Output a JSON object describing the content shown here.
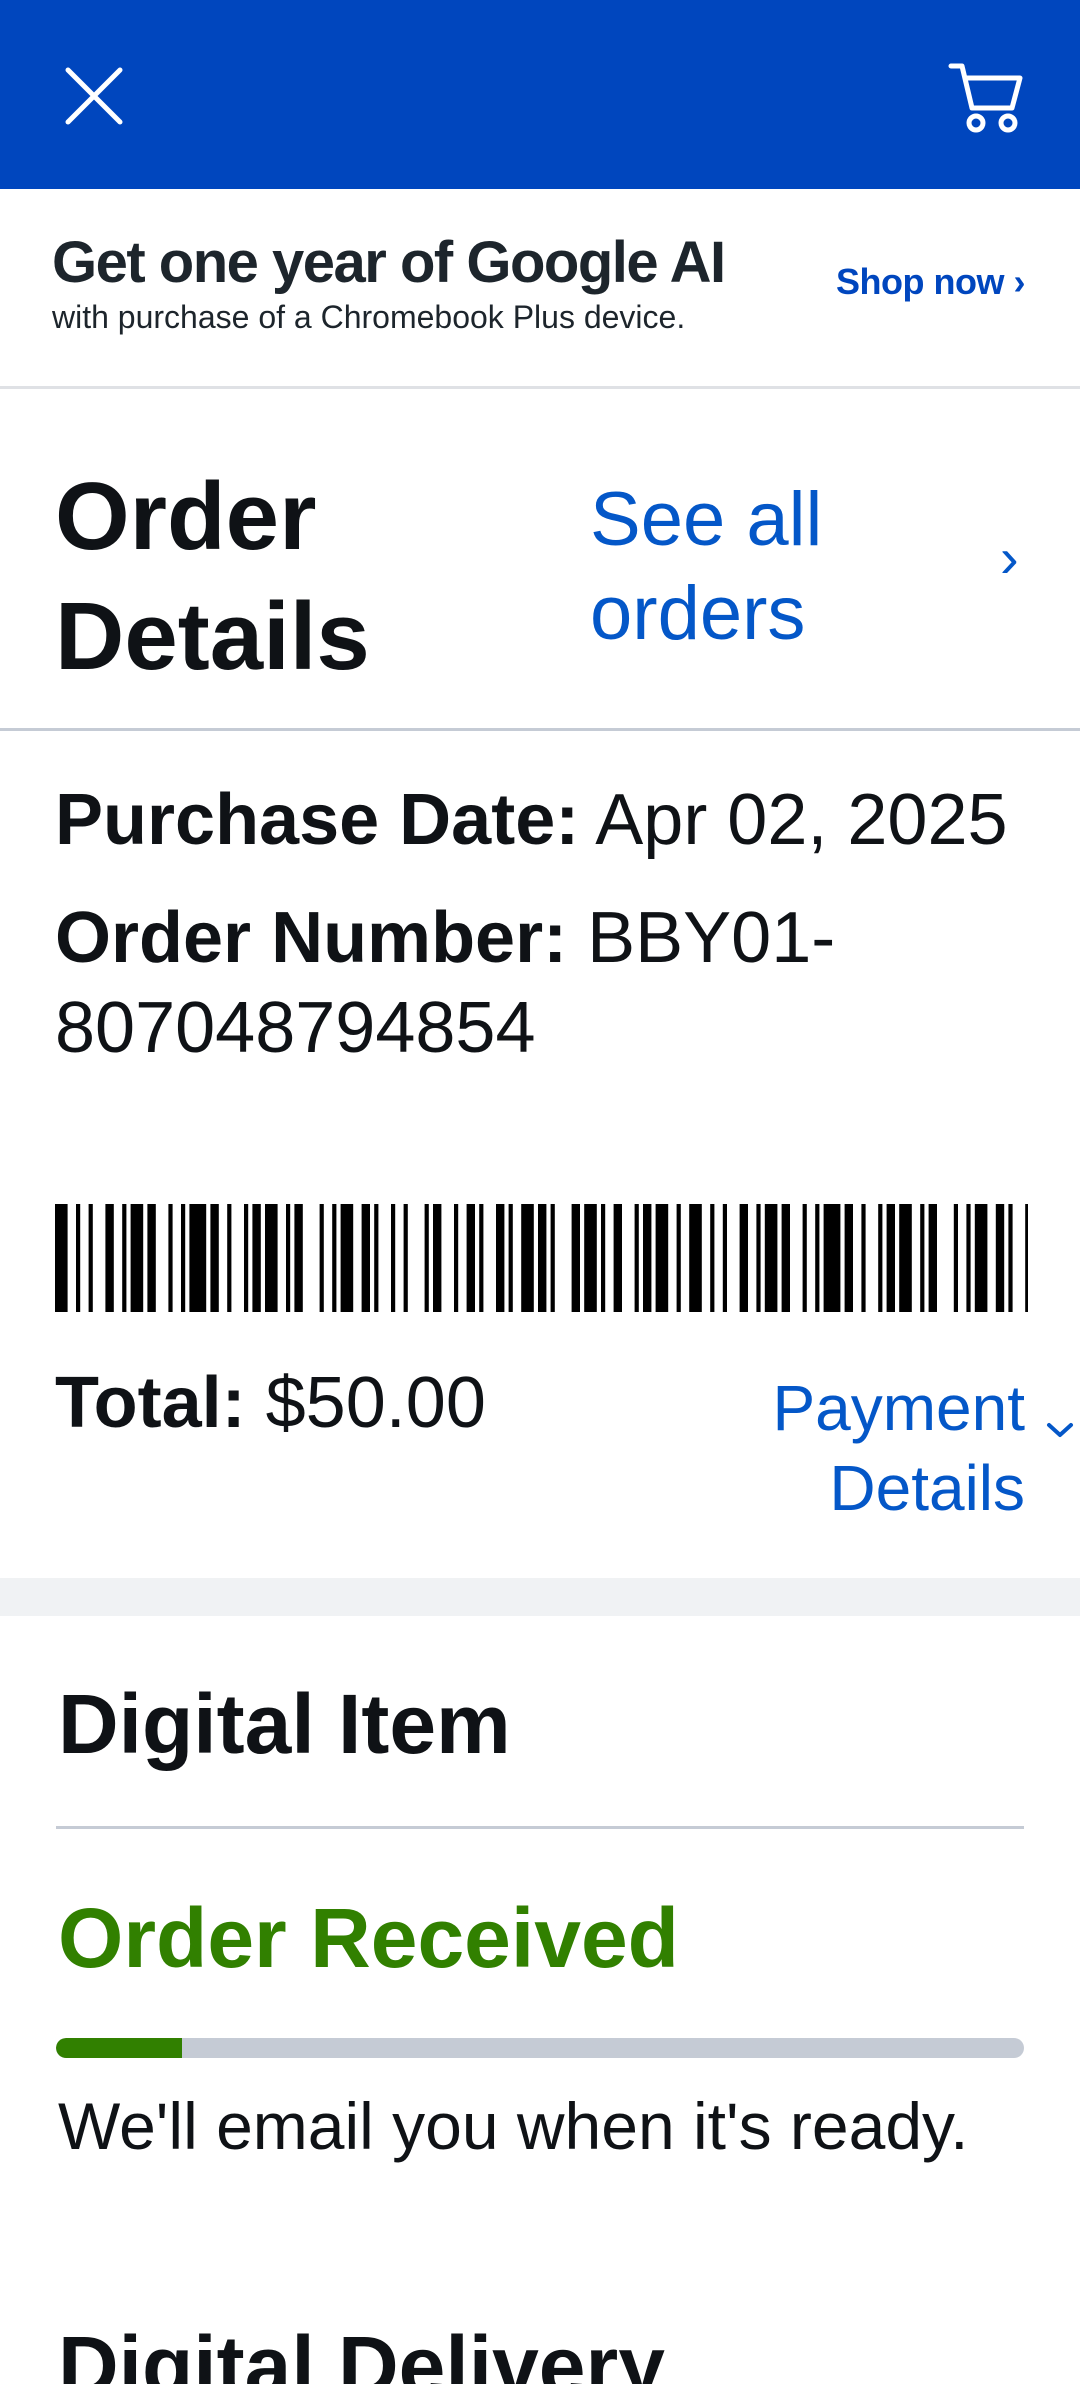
{
  "header": {
    "close_icon": "close-icon",
    "cart_icon": "cart-icon",
    "background": "#0046be"
  },
  "promo": {
    "headline": "Get one year of Google AI",
    "subtext": "with purchase of a Chromebook Plus device.",
    "cta": "Shop now ›"
  },
  "order_header": {
    "title": "Order Details",
    "see_all": "See all orders",
    "chevron": "›"
  },
  "purchase": {
    "date_label": "Purchase Date:",
    "date_value": "Apr 02, 2025",
    "order_label": "Order Number:",
    "order_value": "BBY01-807048794854"
  },
  "totals": {
    "total_label": "Total:",
    "total_value": "$50.00",
    "payment_details": "Payment Details"
  },
  "digital_item": {
    "heading": "Digital Item",
    "status": "Order Received",
    "status_color": "#318000",
    "progress_fraction": 0.13,
    "note": "We'll email you when it's ready."
  },
  "delivery": {
    "heading": "Digital Delivery"
  }
}
